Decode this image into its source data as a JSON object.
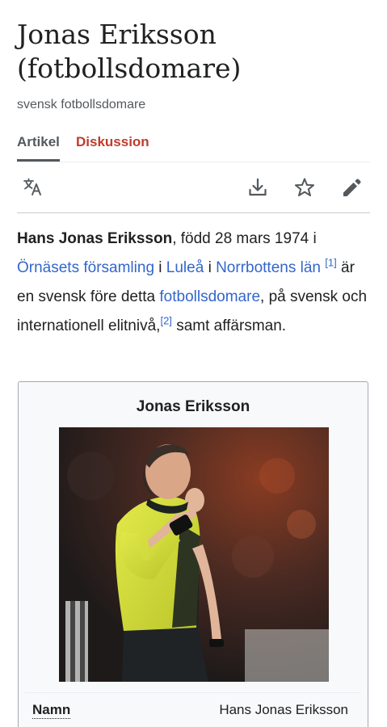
{
  "page": {
    "title": "Jonas Eriksson (fotbollsdomare)",
    "subtitle": "svensk fotbollsdomare"
  },
  "tabs": {
    "article": "Artikel",
    "discussion": "Diskussion"
  },
  "toolbar": {
    "language_icon": "translate-icon",
    "download_icon": "download-icon",
    "watch_icon": "star-icon",
    "edit_icon": "pencil-icon"
  },
  "intro": {
    "name_bold": "Hans Jonas Eriksson",
    "born_text": ", född 28 mars 1974 i ",
    "link_parish": "Örnäsets församling",
    "text_i1": " i ",
    "link_city": "Luleå",
    "text_i2": " i ",
    "link_county": "Norrbottens län",
    "ref1": "[1]",
    "text_middle": " är en svensk före detta ",
    "link_referee": "fotbollsdomare",
    "text_after": ", på svensk och internationell elitnivå,",
    "ref2": "[2]",
    "text_end": " samt affärsman."
  },
  "infobox": {
    "title": "Jonas Eriksson",
    "rows": [
      {
        "label": "Namn",
        "value": "Hans Jonas Eriksson"
      }
    ]
  },
  "colors": {
    "link": "#3366cc",
    "discussion_tab": "#bf3c2c",
    "text": "#202122",
    "muted": "#54595d",
    "referee_shirt": "#d4e03a"
  }
}
